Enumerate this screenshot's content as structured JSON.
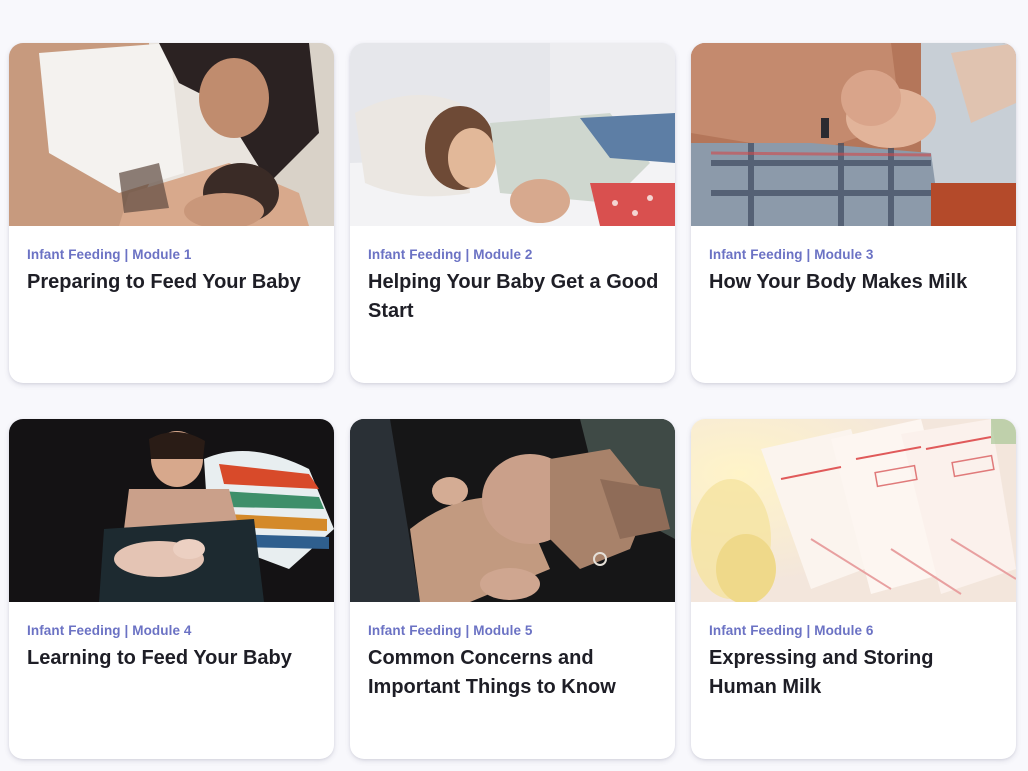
{
  "cards": [
    {
      "category": "Infant Feeding | Module 1",
      "title": "Preparing to Feed Your Baby",
      "image_icon": "photo-breastfeeding-mother"
    },
    {
      "category": "Infant Feeding | Module 2",
      "title": "Helping Your Baby Get a Good Start",
      "image_icon": "photo-side-lying-feeding"
    },
    {
      "category": "Infant Feeding | Module 3",
      "title": "How Your Body Makes Milk",
      "image_icon": "photo-newborn-on-chest"
    },
    {
      "category": "Infant Feeding | Module 4",
      "title": "Learning to Feed Your Baby",
      "image_icon": "photo-mother-holding-baby"
    },
    {
      "category": "Infant Feeding | Module 5",
      "title": "Common Concerns and Important Things to Know",
      "image_icon": "photo-newborn-held-head"
    },
    {
      "category": "Infant Feeding | Module 6",
      "title": "Expressing and Storing Human Milk",
      "image_icon": "photo-milk-storage-bags"
    }
  ],
  "colors": {
    "page_background": "#f8f8fc",
    "card_background": "#ffffff",
    "category_text": "#6b72c4",
    "title_text": "#1e1e26"
  }
}
